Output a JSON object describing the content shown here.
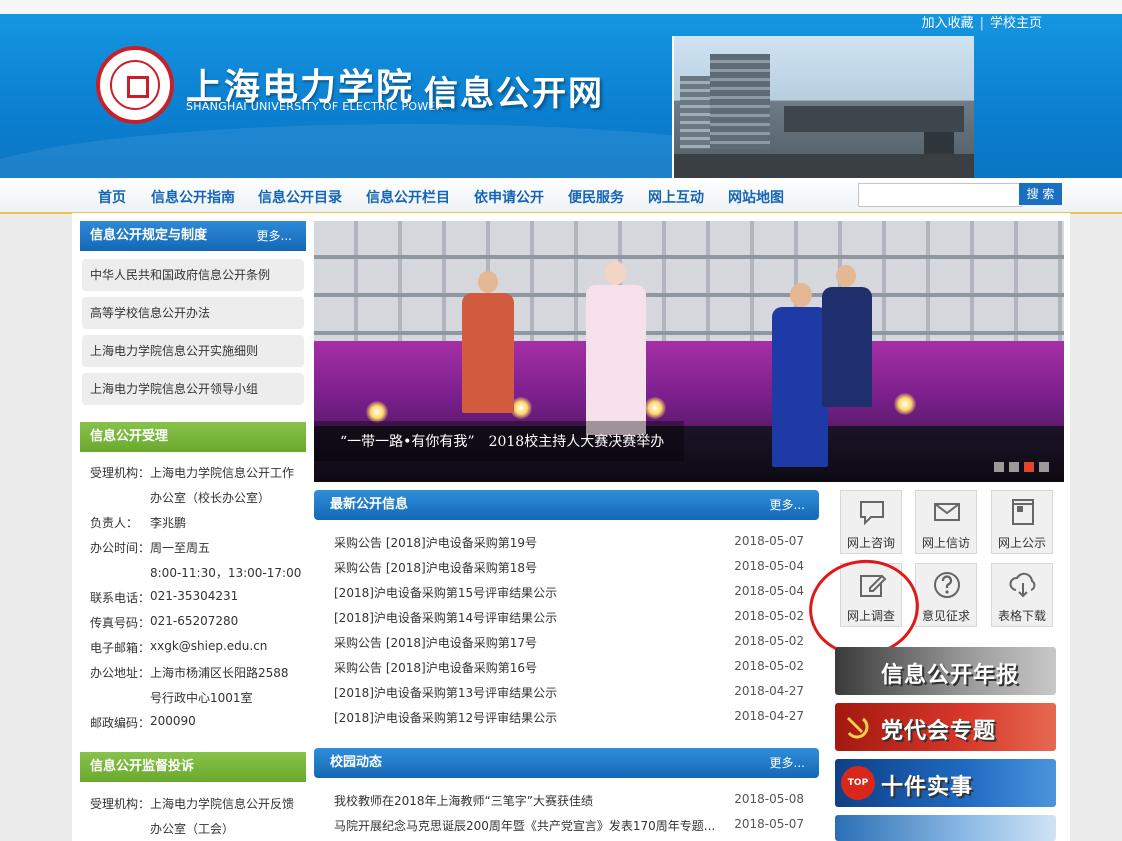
{
  "header": {
    "top_links": [
      "加入收藏",
      "学校主页"
    ],
    "top_links_sep": "|",
    "school_name_cn": "上海电力学院",
    "school_name_en": "SHANGHAI UNIVERSITY OF ELECTRIC POWER",
    "site_title": "信息公开网"
  },
  "nav": {
    "items": [
      "首页",
      "信息公开指南",
      "信息公开目录",
      "信息公开栏目",
      "依申请公开",
      "便民服务",
      "网上互动",
      "网站地图"
    ],
    "search_placeholder": "",
    "search_button": "搜 索"
  },
  "left": {
    "rules": {
      "title": "信息公开规定与制度",
      "more": "更多...",
      "items": [
        "中华人民共和国政府信息公开条例",
        "高等学校信息公开办法",
        "上海电力学院信息公开实施细则",
        "上海电力学院信息公开领导小组"
      ]
    },
    "acceptance": {
      "title": "信息公开受理",
      "rows": [
        {
          "label": "受理机构：",
          "lines": [
            "上海电力学院信息公开工作",
            "办公室（校长办公室）"
          ]
        },
        {
          "label": "负责人：",
          "lines": [
            "李兆鹏"
          ]
        },
        {
          "label": "办公时间：",
          "lines": [
            "周一至周五",
            "8:00-11:30，13:00-17:00"
          ]
        },
        {
          "label": "联系电话：",
          "lines": [
            "021-35304231"
          ]
        },
        {
          "label": "传真号码：",
          "lines": [
            "021-65207280"
          ]
        },
        {
          "label": "电子邮箱：",
          "lines": [
            "xxgk@shiep.edu.cn"
          ]
        },
        {
          "label": "办公地址：",
          "lines": [
            "上海市杨浦区长阳路2588",
            "号行政中心1001室"
          ]
        },
        {
          "label": "邮政编码：",
          "lines": [
            "200090"
          ]
        }
      ]
    },
    "supervision": {
      "title": "信息公开监督投诉",
      "rows": [
        {
          "label": "受理机构：",
          "lines": [
            "上海电力学院信息公开反馈",
            "办公室（工会）"
          ]
        }
      ]
    }
  },
  "banner": {
    "caption": "“一带一路•有你有我”　2018校主持人大赛决赛举办",
    "dots": 4,
    "active_dot": 2
  },
  "latest": {
    "title": "最新公开信息",
    "more": "更多...",
    "items": [
      {
        "title": "采购公告 [2018]沪电设备采购第19号",
        "date": "2018-05-07"
      },
      {
        "title": "采购公告 [2018]沪电设备采购第18号",
        "date": "2018-05-04"
      },
      {
        "title": "[2018]沪电设备采购第15号评审结果公示",
        "date": "2018-05-04"
      },
      {
        "title": "[2018]沪电设备采购第14号评审结果公示",
        "date": "2018-05-02"
      },
      {
        "title": "采购公告 [2018]沪电设备采购第17号",
        "date": "2018-05-02"
      },
      {
        "title": "采购公告 [2018]沪电设备采购第16号",
        "date": "2018-05-02"
      },
      {
        "title": "[2018]沪电设备采购第13号评审结果公示",
        "date": "2018-04-27"
      },
      {
        "title": "[2018]沪电设备采购第12号评审结果公示",
        "date": "2018-04-27"
      }
    ]
  },
  "campus": {
    "title": "校园动态",
    "more": "更多...",
    "items": [
      {
        "title": "我校教师在2018年上海教师“三笔字”大赛获佳绩",
        "date": "2018-05-08"
      },
      {
        "title": "马院开展纪念马克思诞辰200周年暨《共产党宣言》发表170周年专题...",
        "date": "2018-05-07"
      }
    ]
  },
  "services": {
    "tiles": [
      {
        "label": "网上咨询",
        "icon": "chat-bubble-icon"
      },
      {
        "label": "网上信访",
        "icon": "envelope-icon"
      },
      {
        "label": "网上公示",
        "icon": "bulletin-board-icon"
      },
      {
        "label": "网上调查",
        "icon": "pencil-edit-icon"
      },
      {
        "label": "意见征求",
        "icon": "question-mark-icon"
      },
      {
        "label": "表格下载",
        "icon": "cloud-download-icon"
      }
    ]
  },
  "promos": [
    {
      "label": "信息公开年报",
      "badge": "",
      "color": "#8a8a8a"
    },
    {
      "label": "党代会专题",
      "badge": "",
      "color": "#c0281d"
    },
    {
      "label": "十件实事",
      "badge": "TOP 10",
      "color": "#1b5fa8"
    }
  ]
}
